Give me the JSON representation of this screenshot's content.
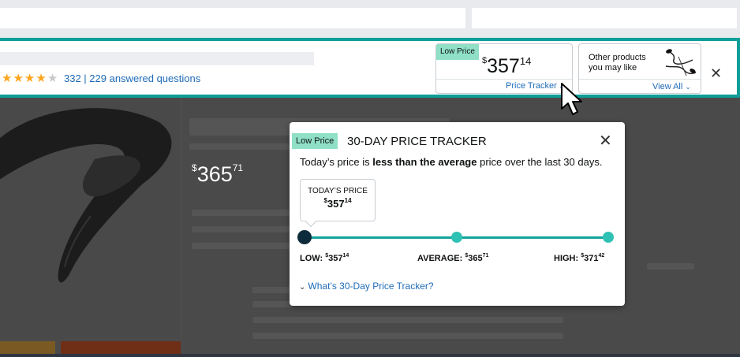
{
  "strip": {
    "review_summary": "332 | 229 answered questions",
    "rating_stars": 4.5,
    "price_badge": "Low Price",
    "price_symbol": "$",
    "price_whole": "357",
    "price_fraction": "14",
    "price_tracker_link": "Price Tracker",
    "other_products_text": "Other products you may like",
    "view_all_link": "View All",
    "close_glyph": "✕"
  },
  "page": {
    "price_symbol": "$",
    "price_whole": "365",
    "price_fraction": "71"
  },
  "popover": {
    "badge": "Low Price",
    "title": "30-DAY PRICE TRACKER",
    "desc_prefix": "Today’s price is ",
    "desc_bold": "less than the average",
    "desc_suffix": " price over the last 30 days.",
    "today_label": "TODAY’S PRICE",
    "today_symbol": "$",
    "today_whole": "357",
    "today_fraction": "14",
    "low_label": "LOW: ",
    "low_symbol": "$",
    "low_whole": "357",
    "low_fraction": "14",
    "avg_label": "AVERAGE: ",
    "avg_symbol": "$",
    "avg_whole": "365",
    "avg_fraction": "71",
    "high_label": "HIGH: ",
    "high_symbol": "$",
    "high_whole": "371",
    "high_fraction": "42",
    "what_link": "What’s 30-Day Price Tracker?",
    "close_glyph": "✕"
  },
  "colors": {
    "accent_teal": "#0d9e99",
    "badge_green": "#8fe0c7",
    "link_blue": "#1e6bb8",
    "star_orange": "#ffa41c"
  },
  "icons": {
    "earbuds": "earbuds-product-icon",
    "cursor": "mouse-pointer-icon",
    "close": "close-icon",
    "chevron": "chevron-down-icon"
  }
}
